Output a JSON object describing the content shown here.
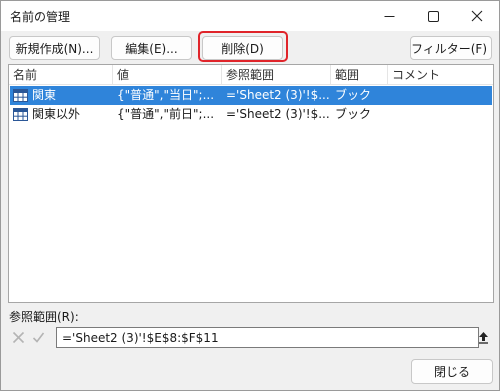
{
  "window": {
    "title": "名前の管理"
  },
  "toolbar": {
    "new_label": "新規作成(N)...",
    "edit_label": "編集(E)...",
    "delete_label": "削除(D)",
    "filter_label": "フィルター(F)"
  },
  "table": {
    "headers": [
      "名前",
      "値",
      "参照範囲",
      "範囲",
      "コメント"
    ],
    "rows": [
      {
        "name": "関東",
        "value": "{\"普通\",\"当日\";...",
        "ref": "='Sheet2 (3)'!$...",
        "scope": "ブック",
        "comment": "",
        "selected": true
      },
      {
        "name": "関東以外",
        "value": "{\"普通\",\"前日\";...",
        "ref": "='Sheet2 (3)'!$...",
        "scope": "ブック",
        "comment": "",
        "selected": false
      }
    ]
  },
  "refers_to": {
    "label": "参照範囲(R):",
    "value": "='Sheet2 (3)'!$E$8:$F$11"
  },
  "footer": {
    "close_label": "閉じる"
  },
  "colors": {
    "selection": "#2f84da",
    "highlight": "#e0242a",
    "dialog_bg": "#f0f0f0"
  }
}
